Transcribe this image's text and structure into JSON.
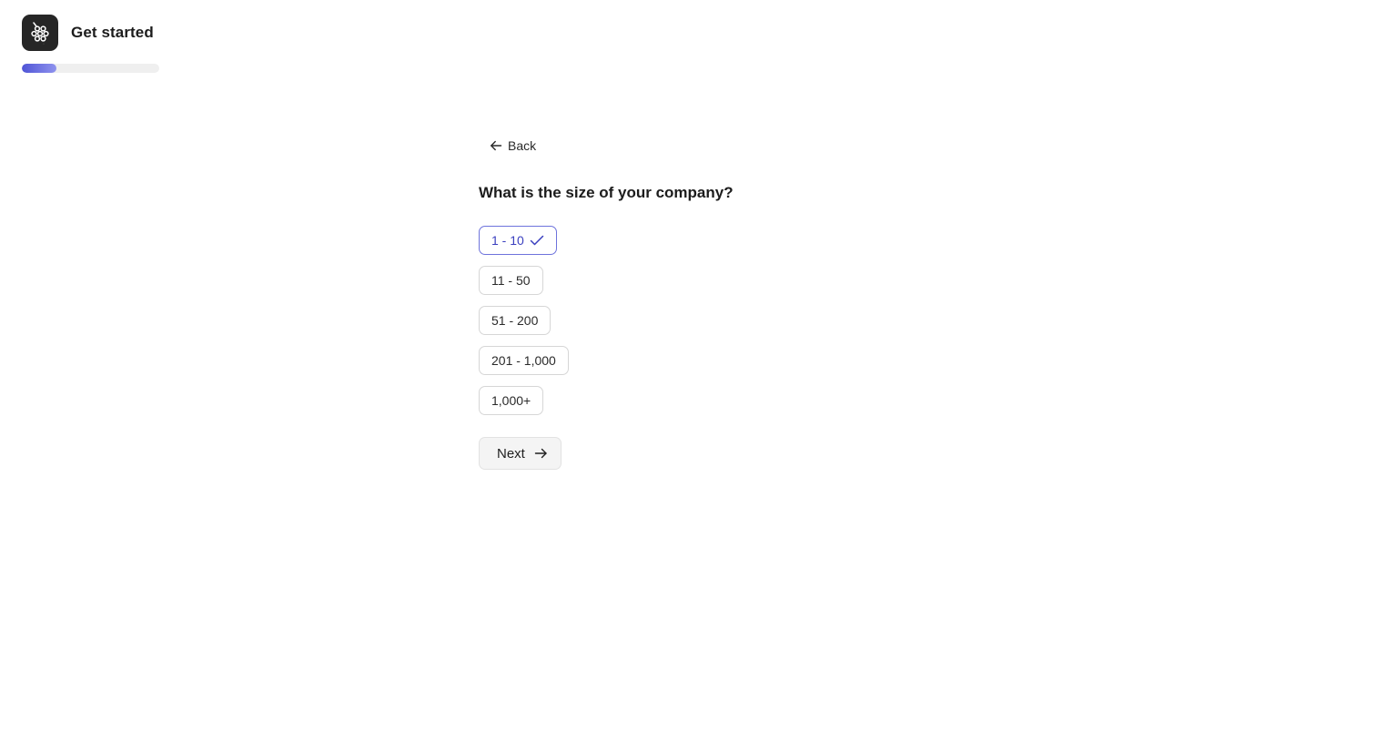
{
  "header": {
    "title": "Get started",
    "logo_icon": "grapes-logo-icon"
  },
  "progress": {
    "fraction": 0.25,
    "fill_color": "#4f54d6"
  },
  "back": {
    "label": "Back",
    "icon": "arrow-left-icon"
  },
  "question": {
    "text": "What is the size of your company?"
  },
  "options": [
    {
      "label": "1 - 10",
      "selected": true
    },
    {
      "label": "11 - 50",
      "selected": false
    },
    {
      "label": "51 - 200",
      "selected": false
    },
    {
      "label": "201 - 1,000",
      "selected": false
    },
    {
      "label": "1,000+",
      "selected": false
    }
  ],
  "next": {
    "label": "Next",
    "icon": "arrow-right-icon"
  },
  "colors": {
    "accent": "#3a3fbf",
    "selected_border": "#6e73dc"
  }
}
